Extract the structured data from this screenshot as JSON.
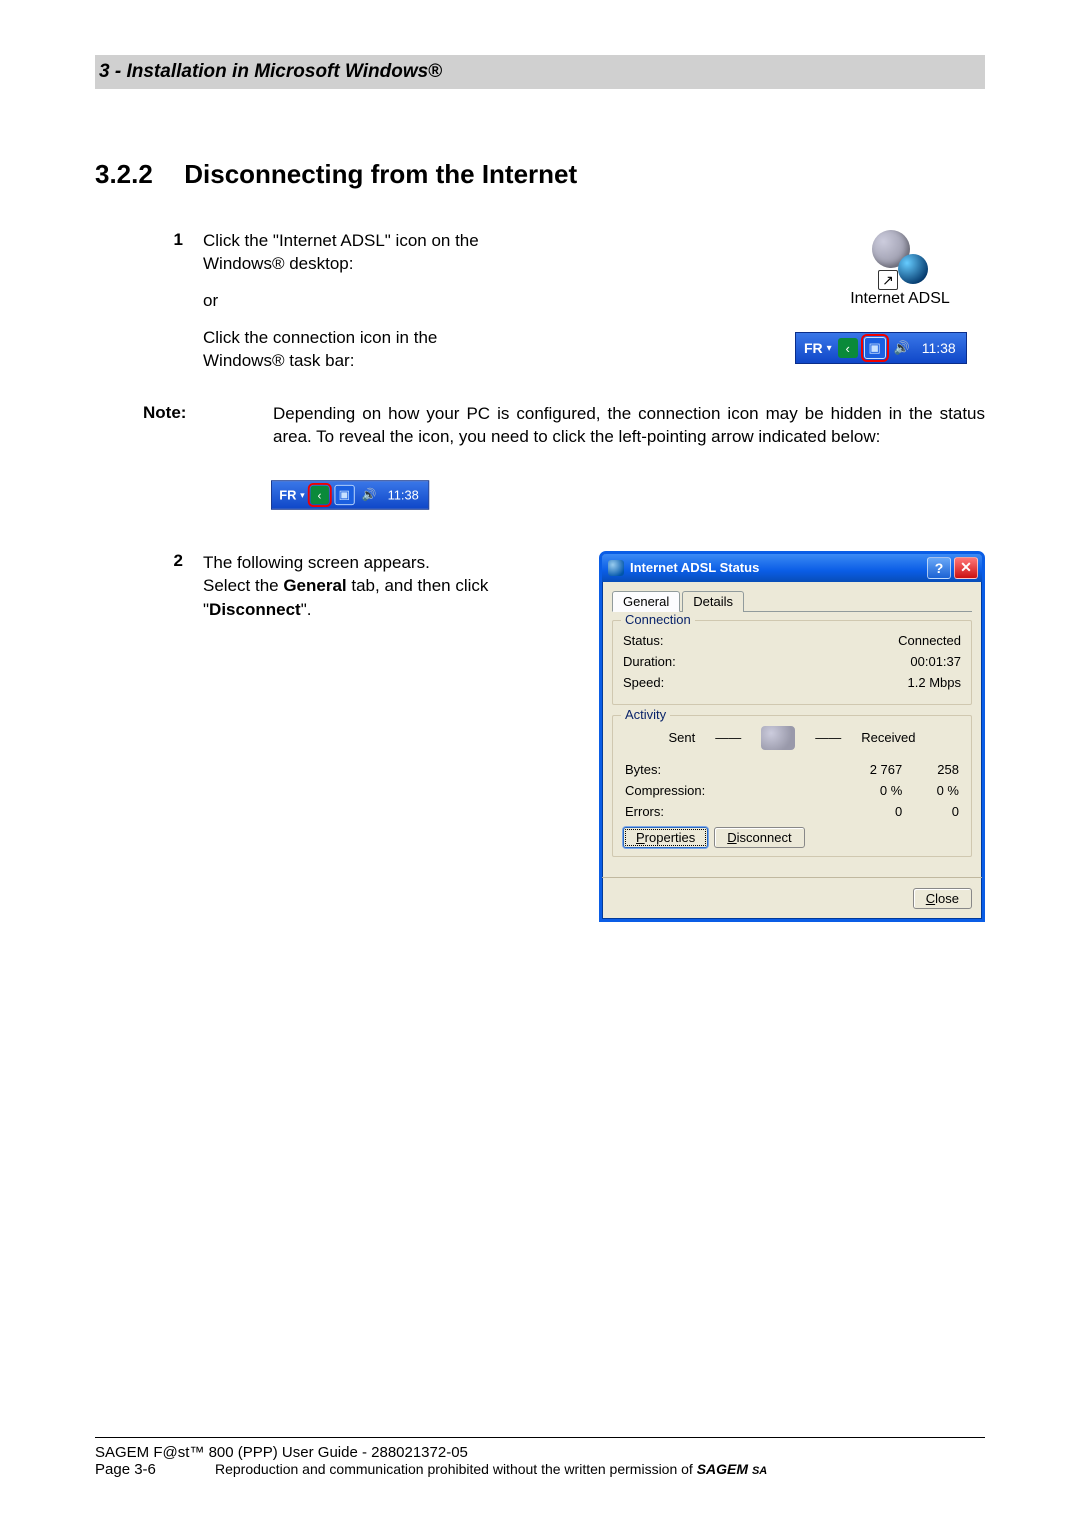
{
  "chapter": {
    "num": "3",
    "title": "Installation in Microsoft Windows",
    "reg": "®"
  },
  "section": {
    "num": "3.2.2",
    "title": "Disconnecting from the Internet"
  },
  "step1": {
    "n": "1",
    "line1a": "Click the \"Internet ADSL\" icon on the",
    "line1b": "Windows",
    "reg": "®",
    "line1c": " desktop:",
    "or": "or",
    "line2a": "Click the connection icon in the",
    "line2b": "Windows",
    "line2c": " task bar:",
    "icon_label": "Internet ADSL"
  },
  "tray": {
    "lang": "FR",
    "chevron": "‹",
    "time": "11:38"
  },
  "note": {
    "label": "Note:",
    "text": "Depending on how your PC is configured, the connection icon may be hidden in the status area.  To reveal the icon, you need to click the left-pointing arrow indicated below:"
  },
  "step2": {
    "n": "2",
    "l1": "The following screen appears.",
    "l2a": "Select the ",
    "general": "General",
    "l2b": " tab, and then click \"",
    "disconnect": "Disconnect",
    "l2c": "\"."
  },
  "dialog": {
    "title": "Internet ADSL Status",
    "tab_general": "General",
    "tab_details": "Details",
    "grp_connection": "Connection",
    "status_k": "Status:",
    "status_v": "Connected",
    "duration_k": "Duration:",
    "duration_v": "00:01:37",
    "speed_k": "Speed:",
    "speed_v": "1.2 Mbps",
    "grp_activity": "Activity",
    "sent": "Sent",
    "received": "Received",
    "bytes_k": "Bytes:",
    "bytes_s": "2 767",
    "bytes_r": "258",
    "comp_k": "Compression:",
    "comp_s": "0 %",
    "comp_r": "0 %",
    "err_k": "Errors:",
    "err_s": "0",
    "err_r": "0",
    "btn_properties": "Properties",
    "btn_disconnect": "Disconnect",
    "btn_close": "Close",
    "help": "?",
    "close_x": "✕",
    "prop_u": "P",
    "prop_rest": "roperties",
    "disc_u": "D",
    "disc_rest": "isconnect",
    "close_u": "C",
    "close_rest": "lose"
  },
  "footer": {
    "l1": "SAGEM F@st™ 800 (PPP) User Guide - 288021372-05",
    "page": "Page 3-6",
    "notice_a": "Reproduction and communication prohibited without the written permission of ",
    "brand": "SAGEM ",
    "brand_sa": "SA"
  }
}
